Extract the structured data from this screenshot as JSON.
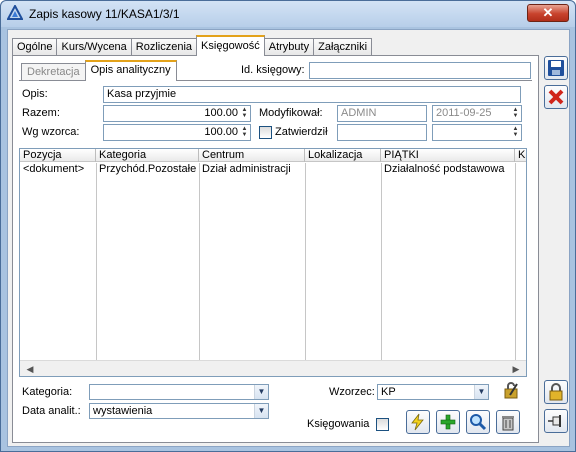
{
  "window": {
    "title": "Zapis kasowy 11/KASA1/3/1"
  },
  "tabs": [
    {
      "label": "Ogólne"
    },
    {
      "label": "Kurs/Wycena"
    },
    {
      "label": "Rozliczenia"
    },
    {
      "label": "Księgowość"
    },
    {
      "label": "Atrybuty"
    },
    {
      "label": "Załączniki"
    }
  ],
  "subtabs": [
    {
      "label": "Dekretacja"
    },
    {
      "label": "Opis analityczny"
    }
  ],
  "form": {
    "id_ksiegowy_label": "Id. księgowy:",
    "id_ksiegowy_value": "",
    "opis_label": "Opis:",
    "opis_value": "Kasa przyjmie",
    "razem_label": "Razem:",
    "razem_value": "100.00",
    "wg_wzorca_label": "Wg wzorca:",
    "wg_wzorca_value": "100.00",
    "modyfikowal_label": "Modyfikował:",
    "modyfikowal_value": "ADMIN",
    "modyfikowal_date": "2011-09-25",
    "zatwierdzil_label": "Zatwierdził",
    "zatwierdzil_value": "",
    "zatwierdzil_date": ""
  },
  "grid": {
    "columns": [
      "Pozycja",
      "Kategoria",
      "Centrum",
      "Lokalizacja",
      "PIĄTKI",
      "K"
    ],
    "rows": [
      [
        "<dokument>",
        "Przychód.Pozostałe",
        "Dział administracji",
        "",
        "Działalność podstawowa",
        ""
      ]
    ]
  },
  "bottom": {
    "kategoria_label": "Kategoria:",
    "kategoria_value": "",
    "data_anal_label": "Data analit.:",
    "data_anal_value": "wystawienia",
    "wzorzec_label": "Wzorzec:",
    "wzorzec_value": "KP",
    "ksiegowania_label": "Księgowania"
  },
  "colors": {
    "titlebar": "#b7cee9",
    "tab_accent": "#e3a21a",
    "close_button": "#c8432d"
  }
}
